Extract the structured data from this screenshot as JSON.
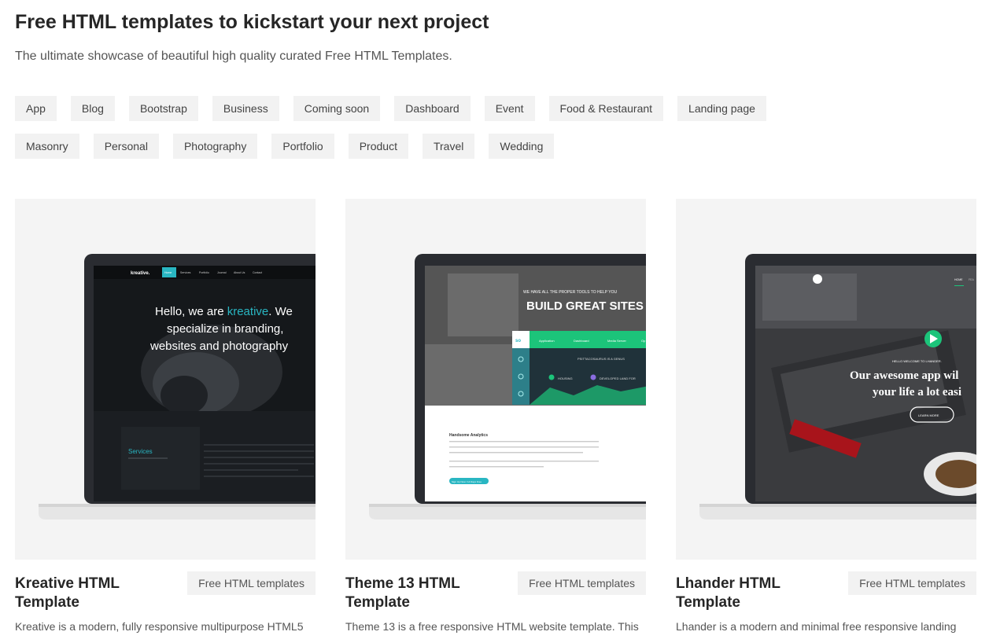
{
  "header": {
    "title": "Free HTML templates to kickstart your next project",
    "subtitle": "The ultimate showcase of beautiful high quality curated Free HTML Templates."
  },
  "tags": {
    "row1": [
      "App",
      "Blog",
      "Bootstrap",
      "Business",
      "Coming soon",
      "Dashboard",
      "Event",
      "Food & Restaurant",
      "Landing page"
    ],
    "row2": [
      "Masonry",
      "Personal",
      "Photography",
      "Portfolio",
      "Product",
      "Travel",
      "Wedding"
    ]
  },
  "cards": [
    {
      "title": "Kreative HTML Template",
      "badge": "Free HTML templates",
      "description": "Kreative is a modern, fully responsive multipurpose HTML5",
      "preview": {
        "logo": "kreative.",
        "nav": [
          "Home",
          "Services",
          "Portfolio",
          "Journal",
          "About Us",
          "Contact"
        ],
        "headline_1a": "Hello, we are ",
        "headline_1b": "kreative",
        "headline_1c": ". We",
        "headline_2": "specialize in branding,",
        "headline_3": "websites and photography",
        "section": "Services"
      }
    },
    {
      "title": "Theme 13 HTML Template",
      "badge": "Free HTML templates",
      "description": "Theme 13 is a free responsive HTML website template. This",
      "preview": {
        "kicker": "WE HAVE ALL THE PROPER TOOLS TO HELP YOU",
        "headline": "BUILD GREAT SITES",
        "logo": "so",
        "tabs": [
          "Application",
          "Dashboard",
          "Media Server",
          "Op"
        ],
        "banner": "PSITTACOSAURUS IS A GENUS",
        "stat_1": "HOUSING",
        "stat_2": "DEVELOPED LAND FOR",
        "section": "Handsome Analytics",
        "button": "Sign Up Now / 14 Days Free"
      }
    },
    {
      "title": "Lhander HTML Template",
      "badge": "Free HTML templates",
      "description": "Lhander is a modern and minimal free responsive landing",
      "preview": {
        "nav": [
          "HOME",
          "FEA"
        ],
        "kicker": "HELLO WELCOME TO LHANDER.",
        "headline_1": "Our awesome app wil",
        "headline_2": "your life a lot easi",
        "button": "LEARN MORE"
      }
    }
  ],
  "colors": {
    "accent_teal": "#29b6c2",
    "green": "#1cc47a",
    "tag_bg": "#f2f2f2"
  }
}
